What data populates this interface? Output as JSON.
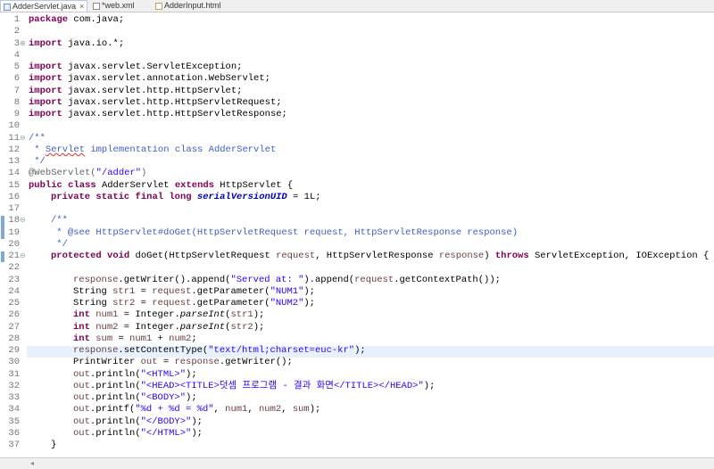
{
  "tabs": [
    {
      "label": "AdderServlet.java",
      "icon": "java-file-icon",
      "active": true
    },
    {
      "label": "*web.xml",
      "icon": "xml-file-icon",
      "active": false
    },
    {
      "label": "AdderInput.html",
      "icon": "html-file-icon",
      "active": false
    }
  ],
  "close_glyph": "×",
  "line_numbers": [
    "1",
    "2",
    "3",
    "4",
    "5",
    "6",
    "7",
    "8",
    "9",
    "10",
    "11",
    "12",
    "13",
    "14",
    "15",
    "16",
    "17",
    "18",
    "19",
    "20",
    "21",
    "22",
    "23",
    "24",
    "25",
    "26",
    "27",
    "28",
    "29",
    "30",
    "31",
    "32",
    "33",
    "34",
    "35",
    "36",
    "37"
  ],
  "code": {
    "l1": [
      "package",
      " com.java;"
    ],
    "l3": [
      "import",
      " java.io.*;"
    ],
    "l5": [
      "import",
      " javax.servlet.ServletException;"
    ],
    "l6": [
      "import",
      " javax.servlet.annotation.WebServlet;"
    ],
    "l7": [
      "import",
      " javax.servlet.http.HttpServlet;"
    ],
    "l8": [
      "import",
      " javax.servlet.http.HttpServletRequest;"
    ],
    "l9": [
      "import",
      " javax.servlet.http.HttpServletResponse;"
    ],
    "l11": "/**",
    "l12a": " * ",
    "l12b": "Servlet",
    "l12c": " implementation class AdderServlet",
    "l13": " */",
    "l14a": "@WebServlet(",
    "l14b": "\"/adder\"",
    "l14c": ")",
    "l15": [
      "public",
      " ",
      "class",
      " AdderServlet ",
      "extends",
      " HttpServlet {"
    ],
    "l16": [
      "private",
      " ",
      "static",
      " ",
      "final",
      " ",
      "long",
      " ",
      "serialVersionUID",
      " = 1L;"
    ],
    "l18": "/**",
    "l19a": " * @see ",
    "l19b": "HttpServlet#doGet(HttpServletRequest request, HttpServletResponse response)",
    "l20": " */",
    "l21": [
      "protected",
      " ",
      "void",
      " doGet(HttpServletRequest ",
      "request",
      ", HttpServletResponse ",
      "response",
      ") ",
      "throws",
      " ServletException, IOException {"
    ],
    "l23": [
      "response",
      ".getWriter().append(",
      "\"Served at: \"",
      ").append(",
      "request",
      ".getContextPath());"
    ],
    "l24": [
      "String ",
      "str1",
      " = ",
      "request",
      ".getParameter(",
      "\"NUM1\"",
      ");"
    ],
    "l25": [
      "String ",
      "str2",
      " = ",
      "request",
      ".getParameter(",
      "\"NUM2\"",
      ");"
    ],
    "l26": [
      "int",
      " ",
      "num1",
      " = Integer.",
      "parseInt",
      "(",
      "str1",
      ");"
    ],
    "l27": [
      "int",
      " ",
      "num2",
      " = Integer.",
      "parseInt",
      "(",
      "str2",
      ");"
    ],
    "l28": [
      "int",
      " ",
      "sum",
      " = ",
      "num1",
      " + ",
      "num2",
      ";"
    ],
    "l29": [
      "response",
      ".setContentType(",
      "\"text/html;charset=euc-kr\"",
      ");"
    ],
    "l30": [
      "PrintWriter ",
      "out",
      " = ",
      "response",
      ".getWriter();"
    ],
    "l31": [
      "out",
      ".println(",
      "\"<HTML>\"",
      ");"
    ],
    "l32": [
      "out",
      ".println(",
      "\"<HEAD><TITLE>덧셈 프로그램 - 결과 화면</TITLE></HEAD>\"",
      ");"
    ],
    "l33": [
      "out",
      ".println(",
      "\"<BODY>\"",
      ");"
    ],
    "l34": [
      "out",
      ".printf(",
      "\"%d + %d = %d\"",
      ", ",
      "num1",
      ", ",
      "num2",
      ", ",
      "sum",
      ");"
    ],
    "l35": [
      "out",
      ".println(",
      "\"</BODY>\"",
      ");"
    ],
    "l36": [
      "out",
      ".println(",
      "\"</HTML>\"",
      ");"
    ],
    "l37": "}"
  },
  "fold_markers": {
    "l3": "⊕",
    "l11": "⊖",
    "l18": "⊖",
    "l21": "⊖"
  },
  "colors": {
    "keyword": "#7f0055",
    "string": "#2a00ff",
    "comment": "#3f5fbf",
    "field": "#0000c0",
    "line_highlight": "#e8f2fe"
  }
}
